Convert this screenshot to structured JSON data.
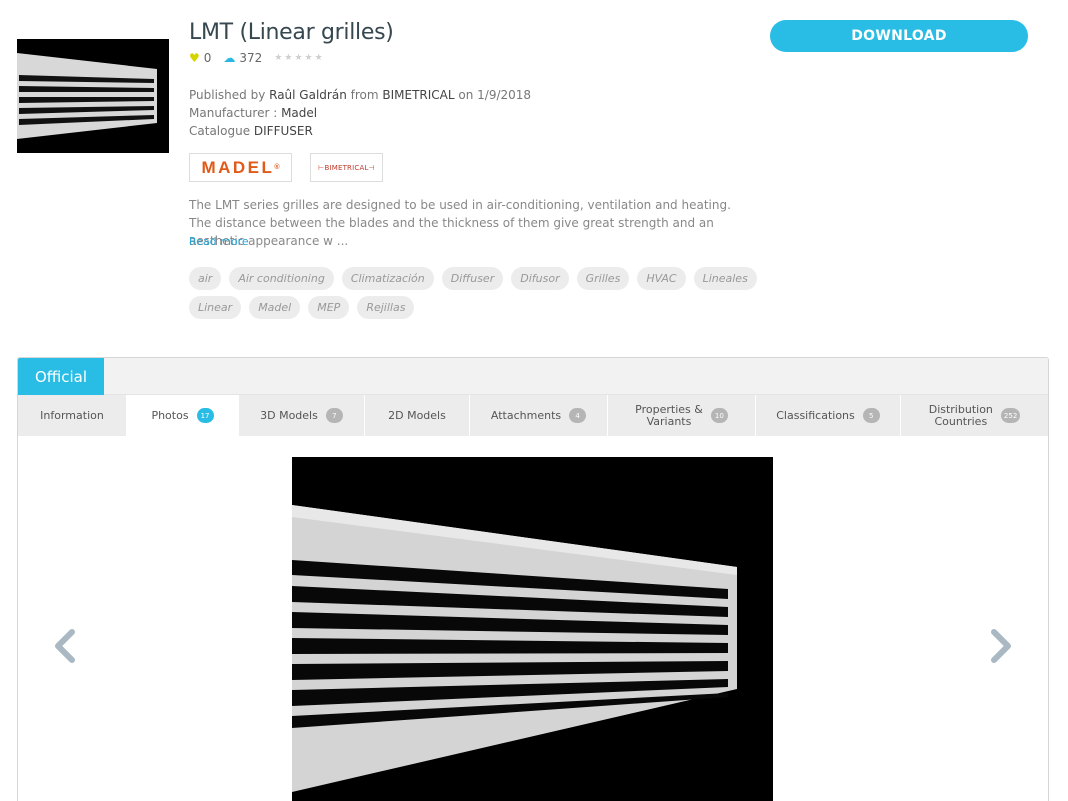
{
  "product": {
    "title": "LMT (Linear grilles)",
    "likes": "0",
    "downloads": "372",
    "stars": "★★★★★",
    "published_prefix": "Published by ",
    "author": "Raûl Galdrán",
    "from_word": " from ",
    "publisher": "BIMETRICAL",
    "date_text": " on 1/9/2018",
    "manufacturer_label": "Manufacturer : ",
    "manufacturer": "Madel",
    "catalogue_label": "Catalogue ",
    "catalogue": "DIFFUSER",
    "logo_madel": "MADEL",
    "logo_madel_mark": "®",
    "logo_bim": "⊢BIMETRICAL⊣",
    "description": "The LMT series grilles are designed to be used in air-conditioning, ventilation and heating. The distance between the blades and the thickness of them give great strength and an aesthetic appearance w ...",
    "read_more": "Read more"
  },
  "tags": [
    "air",
    "Air conditioning",
    "Climatización",
    "Diffuser",
    "Difusor",
    "Grilles",
    "HVAC",
    "Lineales",
    "Linear",
    "Madel",
    "MEP",
    "Rejillas"
  ],
  "download_label": "DOWNLOAD",
  "panel": {
    "official_label": "Official",
    "tabs": [
      {
        "label": "Information",
        "badge": ""
      },
      {
        "label": "Photos",
        "badge": "17"
      },
      {
        "label": "3D Models",
        "badge": "7"
      },
      {
        "label": "2D Models",
        "badge": ""
      },
      {
        "label": "Attachments",
        "badge": "4"
      },
      {
        "label": "Properties &\nVariants",
        "badge": "10"
      },
      {
        "label": "Classifications",
        "badge": "5"
      },
      {
        "label": "Distribution\nCountries",
        "badge": "252"
      }
    ]
  },
  "colors": {
    "accent": "#29bde6",
    "badge_gray": "#b5b5b5",
    "brand_madel": "#e05a1a"
  },
  "icons": {
    "like": "heart-icon",
    "downloads": "cloud-download-icon",
    "prev": "chevron-left-icon",
    "next": "chevron-right-icon"
  }
}
